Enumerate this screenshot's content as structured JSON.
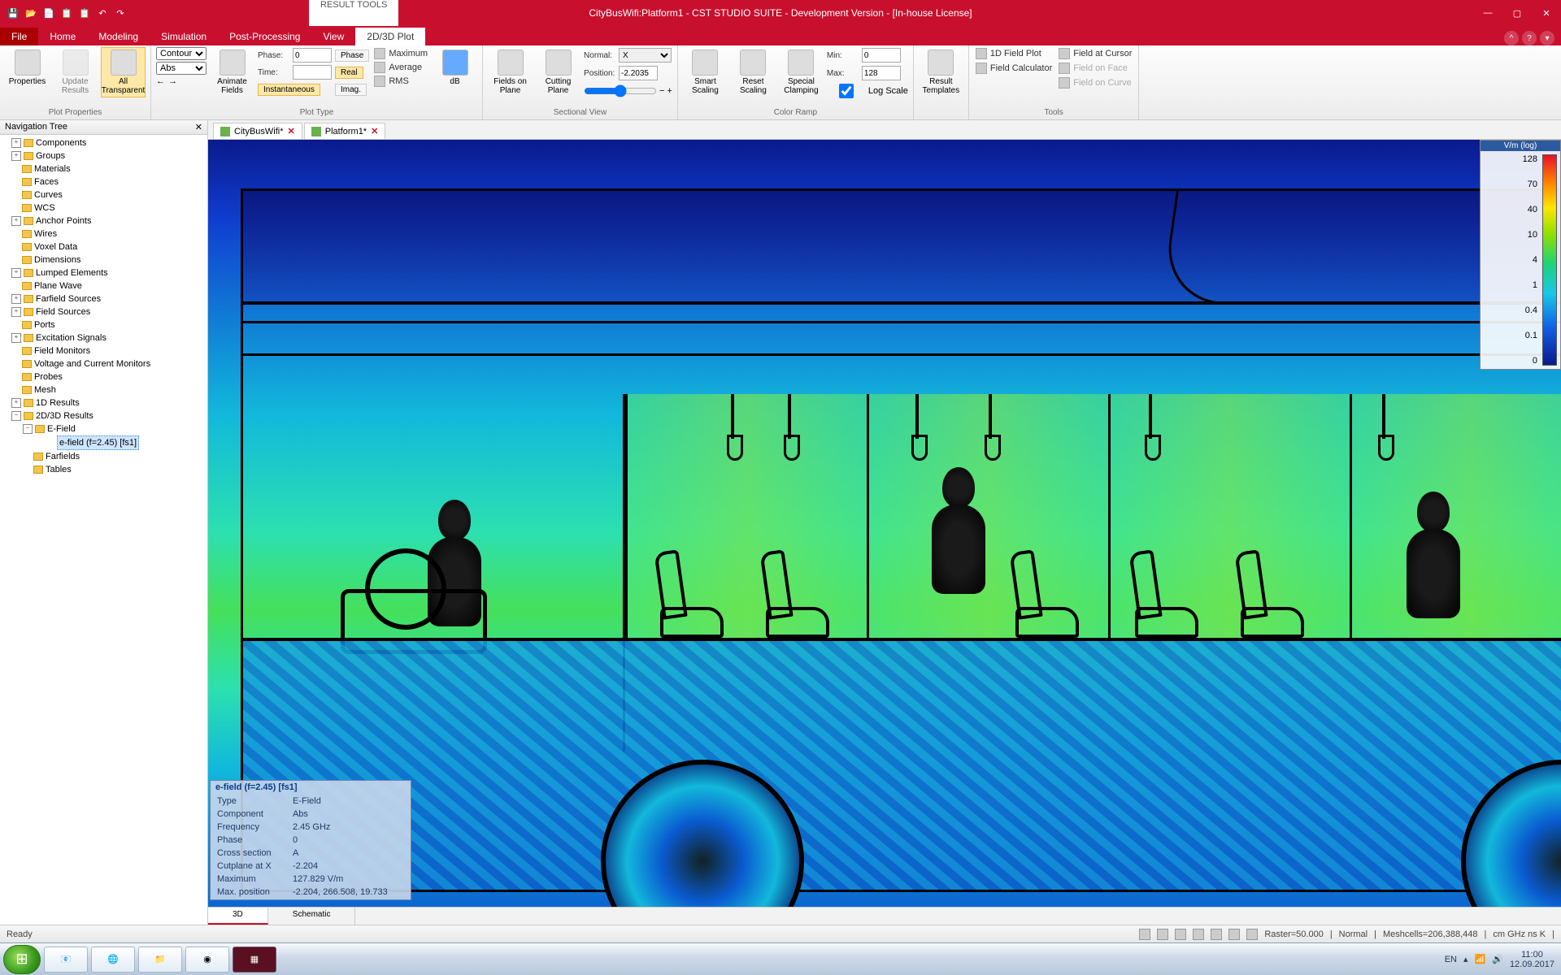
{
  "app": {
    "title": "CityBusWifi:Platform1 - CST STUDIO SUITE - Development Version - [In-house License]",
    "context_tab": "RESULT TOOLS"
  },
  "tabs": [
    "File",
    "Home",
    "Modeling",
    "Simulation",
    "Post-Processing",
    "View",
    "2D/3D Plot"
  ],
  "active_tab": "2D/3D Plot",
  "ribbon": {
    "plot_props": {
      "label": "Plot Properties",
      "properties": "Properties",
      "update": "Update\nResults",
      "transparent": "All\nTransparent"
    },
    "plot_type": {
      "label": "Plot Type",
      "sel1": "Contour",
      "sel2": "Abs",
      "animate": "Animate\nFields",
      "phase_lbl": "Phase:",
      "phase": "0",
      "time_lbl": "Time:",
      "time": "",
      "phase_btn": "Phase",
      "real_btn": "Real",
      "inst_btn": "Instantaneous",
      "max_btn": "Maximum",
      "avg_btn": "Average",
      "imag_btn": "Imag.",
      "rms_btn": "RMS",
      "db": "dB"
    },
    "sectional": {
      "label": "Sectional View",
      "fields_on": "Fields on\nPlane",
      "cutting": "Cutting\nPlane",
      "normal_lbl": "Normal:",
      "normal": "X",
      "pos_lbl": "Position:",
      "pos": "-2.2035"
    },
    "color_ramp": {
      "label": "Color Ramp",
      "smart": "Smart\nScaling",
      "reset": "Reset\nScaling",
      "special": "Special\nClamping",
      "min_lbl": "Min:",
      "min": "0",
      "max_lbl": "Max:",
      "max": "128",
      "log": "Log Scale"
    },
    "templates": {
      "result": "Result\nTemplates"
    },
    "tools": {
      "label": "Tools",
      "fp": "1D Field Plot",
      "fc": "Field Calculator",
      "cursor": "Field at Cursor",
      "face": "Field on Face",
      "curve": "Field on Curve"
    }
  },
  "nav": {
    "header": "Navigation Tree",
    "items": [
      "Components",
      "Groups",
      "Materials",
      "Faces",
      "Curves",
      "WCS",
      "Anchor Points",
      "Wires",
      "Voxel Data",
      "Dimensions",
      "Lumped Elements",
      "Plane Wave",
      "Farfield Sources",
      "Field Sources",
      "Ports",
      "Excitation Signals",
      "Field Monitors",
      "Voltage and Current Monitors",
      "Probes",
      "Mesh",
      "1D Results",
      "2D/3D Results"
    ],
    "sub": {
      "efield": "E-Field",
      "leaf": "e-field (f=2.45) [fs1]",
      "farfields": "Farfields",
      "tables": "Tables"
    }
  },
  "doctabs": [
    {
      "name": "CityBusWifi*"
    },
    {
      "name": "Platform1*"
    }
  ],
  "colorbar": {
    "title": "V/m (log)",
    "ticks": [
      "128",
      "70",
      "40",
      "10",
      "4",
      "1",
      "0.4",
      "0.1",
      "0"
    ]
  },
  "info": {
    "title": "e-field (f=2.45) [fs1]",
    "rows": [
      [
        "Type",
        "E-Field"
      ],
      [
        "Component",
        "Abs"
      ],
      [
        "Frequency",
        "2.45 GHz"
      ],
      [
        "Phase",
        "0"
      ],
      [
        "Cross section",
        "A"
      ],
      [
        "Cutplane at X",
        "-2.204"
      ],
      [
        "Maximum",
        "127.829 V/m"
      ],
      [
        "Max. position",
        "-2.204,  266.508,   19.733"
      ]
    ]
  },
  "bottom_tabs": [
    "3D",
    "Schematic"
  ],
  "status": {
    "ready": "Ready",
    "raster": "Raster=50.000",
    "mode": "Normal",
    "mesh": "Meshcells=206,388,448",
    "units": "cm  GHz  ns  K"
  },
  "tray": {
    "lang": "EN",
    "time": "11:00",
    "date": "12.09.2017"
  }
}
